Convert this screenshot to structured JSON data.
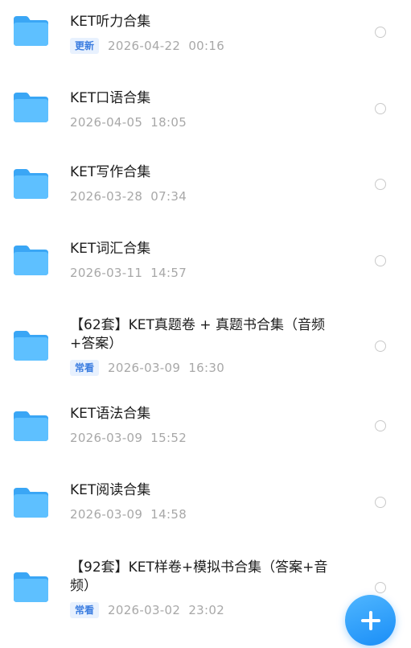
{
  "files": [
    {
      "name": "KET听力合集",
      "badge": "更新",
      "date": "2026-04-22  00:16"
    },
    {
      "name": "KET口语合集",
      "badge": null,
      "date": "2026-04-05  18:05"
    },
    {
      "name": "KET写作合集",
      "badge": null,
      "date": "2026-03-28  07:34"
    },
    {
      "name": "KET词汇合集",
      "badge": null,
      "date": "2026-03-11  14:57"
    },
    {
      "name": "【62套】KET真题卷 + 真题书合集（音频+答案）",
      "badge": "常看",
      "date": "2026-03-09  16:30"
    },
    {
      "name": "KET语法合集",
      "badge": null,
      "date": "2026-03-09  15:52"
    },
    {
      "name": "KET阅读合集",
      "badge": null,
      "date": "2026-03-09  14:58"
    },
    {
      "name": "【92套】KET样卷+模拟书合集（答案+音频）",
      "badge": "常看",
      "date": "2026-03-02  23:02"
    }
  ],
  "icons": {
    "folder": "folder-icon",
    "select": "radio-circle-icon",
    "fab": "plus-icon"
  },
  "colors": {
    "folder": "#47b3fb",
    "badge_bg": "#e8f1fe",
    "badge_text": "#3b7de0",
    "fab": "#2196f7"
  }
}
